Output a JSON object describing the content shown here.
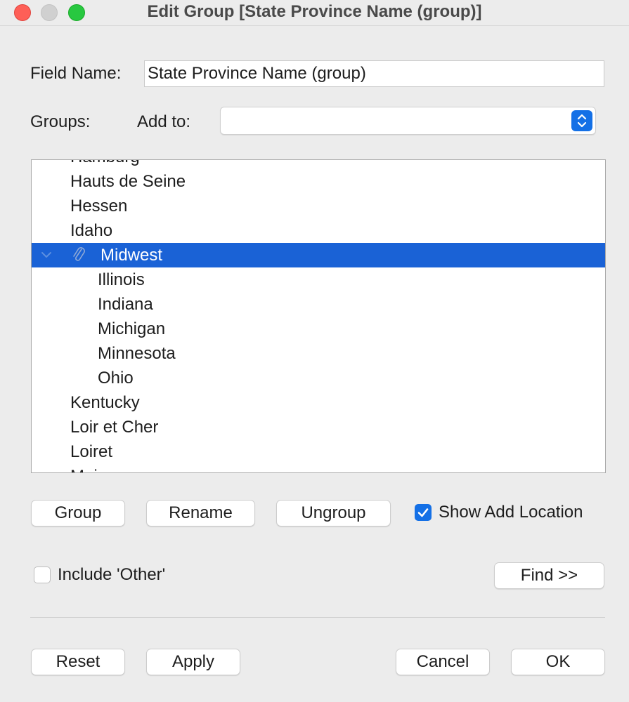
{
  "window": {
    "title": "Edit Group [State Province Name (group)]"
  },
  "field_name": {
    "label": "Field Name:",
    "value": "State Province Name (group)"
  },
  "groups": {
    "label": "Groups:",
    "add_to_label": "Add to:",
    "add_to_value": ""
  },
  "list": {
    "items": [
      {
        "label": "Hamburg",
        "level": 0
      },
      {
        "label": "Hauts de Seine",
        "level": 0
      },
      {
        "label": "Hessen",
        "level": 0
      },
      {
        "label": "Idaho",
        "level": 0
      },
      {
        "label": "Midwest",
        "level": 0,
        "selected": true,
        "is_group": true,
        "expanded": true
      },
      {
        "label": "Illinois",
        "level": 1
      },
      {
        "label": "Indiana",
        "level": 1
      },
      {
        "label": "Michigan",
        "level": 1
      },
      {
        "label": "Minnesota",
        "level": 1
      },
      {
        "label": "Ohio",
        "level": 1
      },
      {
        "label": "Kentucky",
        "level": 0
      },
      {
        "label": "Loir et Cher",
        "level": 0
      },
      {
        "label": "Loiret",
        "level": 0
      },
      {
        "label": "Maine",
        "level": 0
      }
    ]
  },
  "buttons": {
    "group": "Group",
    "rename": "Rename",
    "ungroup": "Ungroup",
    "find": "Find >>",
    "reset": "Reset",
    "apply": "Apply",
    "cancel": "Cancel",
    "ok": "OK"
  },
  "checkboxes": {
    "show_add_location": {
      "label": "Show Add Location",
      "checked": true
    },
    "include_other": {
      "label": "Include 'Other'",
      "checked": false
    }
  },
  "colors": {
    "selection": "#1a62d6",
    "accent": "#1470e6"
  }
}
